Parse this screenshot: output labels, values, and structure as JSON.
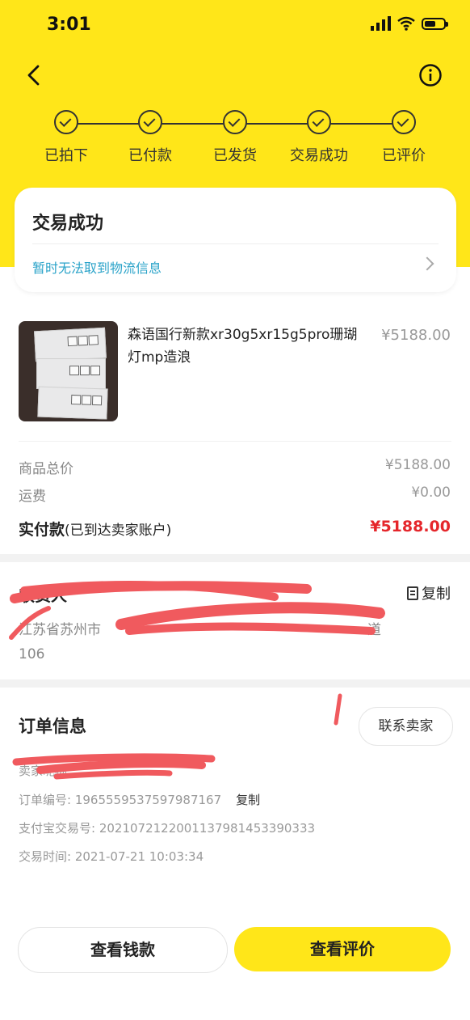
{
  "status_bar": {
    "time": "3:01"
  },
  "steps": [
    "已拍下",
    "已付款",
    "已发货",
    "交易成功",
    "已评价"
  ],
  "status_card": {
    "title": "交易成功",
    "logistics": "暂时无法取到物流信息"
  },
  "product": {
    "name": "森语国行新款xr30g5xr15g5pro珊瑚灯mp造浪",
    "price": "¥5188.00"
  },
  "summary": {
    "goods_label": "商品总价",
    "goods_value": "¥5188.00",
    "shipping_label": "运费",
    "shipping_value": "¥0.00",
    "paid_label": "实付款",
    "paid_note": "(已到达卖家账户)",
    "paid_value": "¥5188.00"
  },
  "address": {
    "label": "收货人",
    "copy": "复制",
    "line1": "江苏省苏州市",
    "line1_end": "道",
    "line2": "106"
  },
  "order_info": {
    "title": "订单信息",
    "contact_label": "联系卖家",
    "seller_label": "卖家昵称",
    "order_no": "订单编号: 1965559537597987167",
    "copy": "复制",
    "alipay_no": "支付宝交易号: 2021072122001137981453390333",
    "trade_time": "交易时间: 2021-07-21 10:03:34"
  },
  "actions": {
    "wallet": "查看钱款",
    "review": "查看评价"
  },
  "colors": {
    "brand_yellow": "#FFE619",
    "price_red": "#e5262b",
    "link_blue": "#2aa3c9",
    "redaction": "#f05a5e"
  }
}
